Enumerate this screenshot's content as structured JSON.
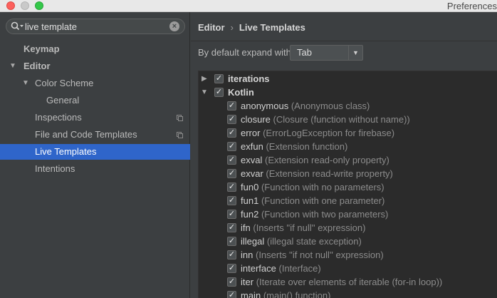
{
  "window": {
    "title": "Preferences"
  },
  "search": {
    "value": "live template"
  },
  "sidebar": {
    "items": [
      {
        "label": "Keymap"
      },
      {
        "label": "Editor"
      },
      {
        "label": "Color Scheme"
      },
      {
        "label": "General"
      },
      {
        "label": "Inspections"
      },
      {
        "label": "File and Code Templates"
      },
      {
        "label": "Live Templates"
      },
      {
        "label": "Intentions"
      }
    ]
  },
  "breadcrumb": {
    "parent": "Editor",
    "separator": "›",
    "current": "Live Templates"
  },
  "expand": {
    "label": "By default expand with",
    "value": "Tab"
  },
  "groups": [
    {
      "name": "iterations"
    },
    {
      "name": "Kotlin"
    }
  ],
  "templates": [
    {
      "name": "anonymous",
      "desc": "(Anonymous class)"
    },
    {
      "name": "closure",
      "desc": "(Closure (function without name))"
    },
    {
      "name": "error",
      "desc": "(ErrorLogException for firebase)"
    },
    {
      "name": "exfun",
      "desc": "(Extension function)"
    },
    {
      "name": "exval",
      "desc": "(Extension read-only property)"
    },
    {
      "name": "exvar",
      "desc": "(Extension read-write property)"
    },
    {
      "name": "fun0",
      "desc": "(Function with no parameters)"
    },
    {
      "name": "fun1",
      "desc": "(Function with one parameter)"
    },
    {
      "name": "fun2",
      "desc": "(Function with two parameters)"
    },
    {
      "name": "ifn",
      "desc": "(Inserts ''if null'' expression)"
    },
    {
      "name": "illegal",
      "desc": "(illegal state exception)"
    },
    {
      "name": "inn",
      "desc": "(Inserts ''if not null'' expression)"
    },
    {
      "name": "interface",
      "desc": "(Interface)"
    },
    {
      "name": "iter",
      "desc": "(Iterate over elements of iterable (for-in loop))"
    },
    {
      "name": "main",
      "desc": "(main() function)"
    }
  ],
  "checkmark": "✓",
  "colors": {
    "selection": "#2f65ca",
    "panel": "#3c3f41",
    "list_bg": "#2b2b2b"
  }
}
